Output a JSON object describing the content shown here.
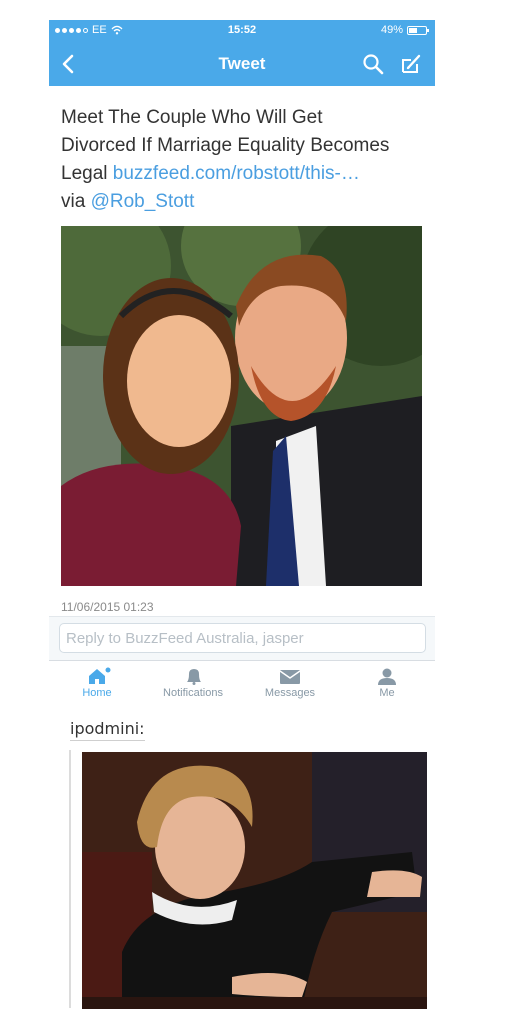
{
  "status_bar": {
    "carrier": "EE",
    "time": "15:52",
    "battery_text": "49%",
    "battery_level": 0.49
  },
  "nav": {
    "title": "Tweet",
    "back_icon": "chevron-left-icon",
    "search_icon": "search-icon",
    "compose_icon": "compose-icon"
  },
  "tweet": {
    "text_line1": "Meet The Couple Who Will Get",
    "text_line2": "Divorced If Marriage Equality Becomes",
    "text_line3_prefix": "Legal ",
    "link": "buzzfeed.com/robstott/this-…",
    "via_prefix": "via ",
    "mention": "@Rob_Stott",
    "timestamp": "11/06/2015 01:23"
  },
  "reply": {
    "placeholder": "Reply to BuzzFeed Australia, jasper"
  },
  "tabs": [
    {
      "label": "Home",
      "icon": "home-icon"
    },
    {
      "label": "Notifications",
      "icon": "bell-icon"
    },
    {
      "label": "Messages",
      "icon": "envelope-icon"
    },
    {
      "label": "Me",
      "icon": "person-icon"
    }
  ],
  "reblog": {
    "username": "ipodmini:"
  },
  "colors": {
    "twitter_blue": "#4aa9e9",
    "link_blue": "#4a9ee0",
    "text": "#333333"
  }
}
